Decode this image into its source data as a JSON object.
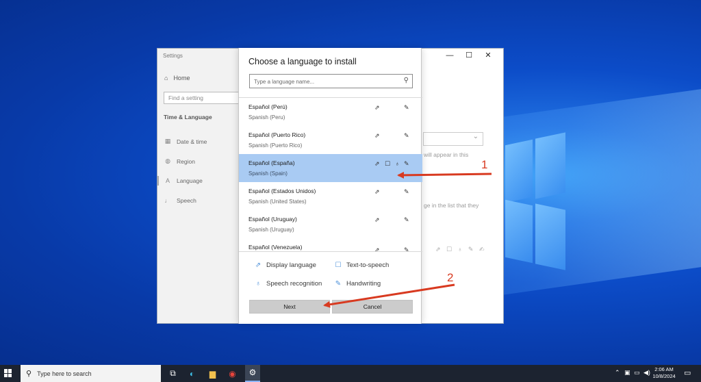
{
  "settings": {
    "title": "Settings",
    "home": "Home",
    "search_placeholder": "Find a setting",
    "section": "Time & Language",
    "nav": [
      {
        "label": "Date & time",
        "icon": "calendar-icon"
      },
      {
        "label": "Region",
        "icon": "globe-icon"
      },
      {
        "label": "Language",
        "icon": "language-icon"
      },
      {
        "label": "Speech",
        "icon": "microphone-icon"
      }
    ],
    "selected_nav": "Language",
    "background_text": [
      "will appear in this",
      "ge in the list that they"
    ]
  },
  "window_controls": {
    "minimize": "—",
    "maximize": "☐",
    "close": "✕"
  },
  "dialog": {
    "title": "Choose a language to install",
    "search_placeholder": "Type a language name...",
    "languages": [
      {
        "name": "Español (Perú)",
        "sub": "Spanish (Peru)",
        "features": [
          "display",
          "handwriting"
        ],
        "selected": false
      },
      {
        "name": "Español (Puerto Rico)",
        "sub": "Spanish (Puerto Rico)",
        "features": [
          "display",
          "handwriting"
        ],
        "selected": false
      },
      {
        "name": "Español (España)",
        "sub": "Spanish (Spain)",
        "features": [
          "display",
          "tts",
          "speech",
          "handwriting"
        ],
        "selected": true
      },
      {
        "name": "Español (Estados Unidos)",
        "sub": "Spanish (United States)",
        "features": [
          "display",
          "handwriting"
        ],
        "selected": false
      },
      {
        "name": "Español (Uruguay)",
        "sub": "Spanish (Uruguay)",
        "features": [
          "display",
          "handwriting"
        ],
        "selected": false
      },
      {
        "name": "Español (Venezuela)",
        "sub": "",
        "features": [
          "display",
          "handwriting"
        ],
        "selected": false
      }
    ],
    "legend": {
      "display": "Display language",
      "tts": "Text-to-speech",
      "speech": "Speech recognition",
      "handwriting": "Handwriting"
    },
    "next_label": "Next",
    "cancel_label": "Cancel"
  },
  "annotations": {
    "one": "1",
    "two": "2",
    "color": "#d83a20"
  },
  "taskbar": {
    "search_text": "Type here to search",
    "time": "2:06 AM",
    "date": "10/8/2024"
  }
}
